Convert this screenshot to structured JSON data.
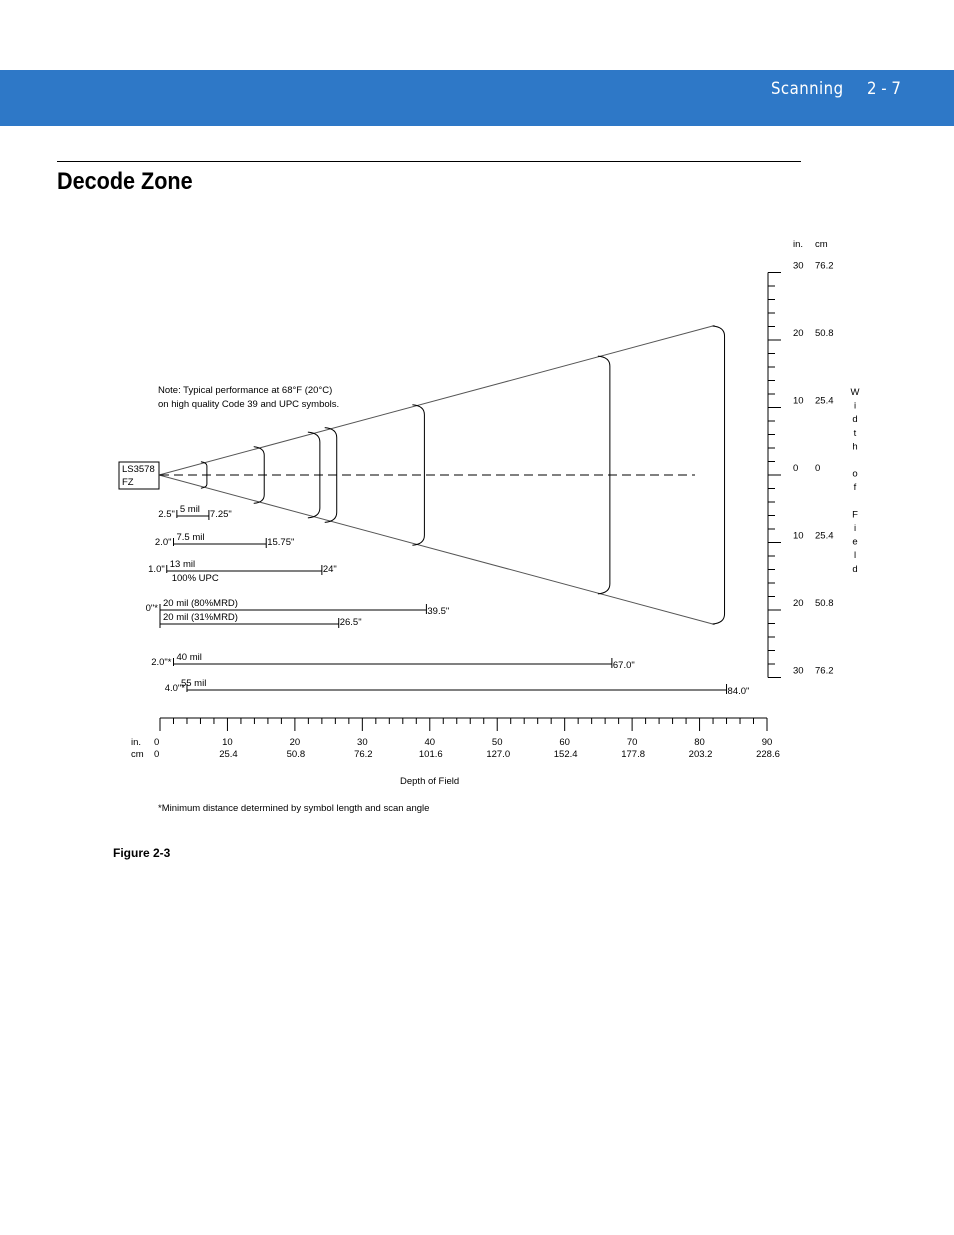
{
  "header": {
    "section": "Scanning",
    "page_number": "2 - 7",
    "band_color": "#2e78c7"
  },
  "page": {
    "title": "Decode Zone",
    "figure_caption": "Figure 2-3"
  },
  "diagram": {
    "scanner_label_line1": "LS3578",
    "scanner_label_line2": "FZ",
    "note_line1": "Note: Typical performance at 68°F (20°C)",
    "note_line2": "on high quality Code 39 and UPC symbols.",
    "footnote": "*Minimum distance determined by symbol length and scan angle",
    "depth_axis": {
      "label": "Depth of Field",
      "unit_in": "in.",
      "unit_cm": "cm",
      "range_in": [
        0,
        90
      ],
      "major_ticks_in": [
        "0",
        "10",
        "20",
        "30",
        "40",
        "50",
        "60",
        "70",
        "80",
        "90"
      ],
      "major_ticks_cm": [
        "0",
        "25.4",
        "50.8",
        "76.2",
        "101.6",
        "127.0",
        "152.4",
        "177.8",
        "203.2",
        "228.6"
      ],
      "minor_step_in": 2
    },
    "width_axis": {
      "label_letters": [
        "W",
        "i",
        "d",
        "t",
        "h",
        "",
        "o",
        "f",
        "",
        "F",
        "i",
        "e",
        "l",
        "d"
      ],
      "unit_in": "in.",
      "unit_cm": "cm",
      "range_in": [
        -30,
        30
      ],
      "ticks": [
        {
          "value": 30,
          "in": "30",
          "cm": "76.2"
        },
        {
          "value": 20,
          "in": "20",
          "cm": "50.8"
        },
        {
          "value": 10,
          "in": "10",
          "cm": "25.4"
        },
        {
          "value": 0,
          "in": "0",
          "cm": "0"
        },
        {
          "value": -10,
          "in": "10",
          "cm": "25.4"
        },
        {
          "value": -20,
          "in": "20",
          "cm": "50.8"
        },
        {
          "value": -30,
          "in": "30",
          "cm": "76.2"
        }
      ],
      "minor_step_in": 2
    },
    "zones": [
      {
        "name": "5 mil",
        "near_in": 2.5,
        "far_in": 7.25,
        "near_label": "2.5\"",
        "far_label": "7.25\"",
        "sublabel": ""
      },
      {
        "name": "7.5 mil",
        "near_in": 2.0,
        "far_in": 15.75,
        "near_label": "2.0\"",
        "far_label": "15.75\"",
        "sublabel": ""
      },
      {
        "name": "13 mil",
        "near_in": 1.0,
        "far_in": 24.0,
        "near_label": "1.0\"",
        "far_label": "24\"",
        "sublabel": "100% UPC"
      },
      {
        "name": "20 mil (80%MRD)",
        "near_in": 0,
        "far_in": 39.5,
        "near_label": "0\"*",
        "far_label": "39.5\"",
        "sublabel": ""
      },
      {
        "name": "20 mil (31%MRD)",
        "near_in": 0,
        "far_in": 26.5,
        "near_label": "",
        "far_label": "26.5\"",
        "sublabel": ""
      },
      {
        "name": "40 mil",
        "near_in": 2.0,
        "far_in": 67.0,
        "near_label": "2.0\"*",
        "far_label": "67.0\"",
        "sublabel": ""
      },
      {
        "name": "55 mil",
        "near_in": 4.0,
        "far_in": 84.0,
        "near_label": "4.0\"*",
        "far_label": "84.0\"",
        "sublabel": ""
      }
    ],
    "beam_half_width_at_84in": 22
  }
}
